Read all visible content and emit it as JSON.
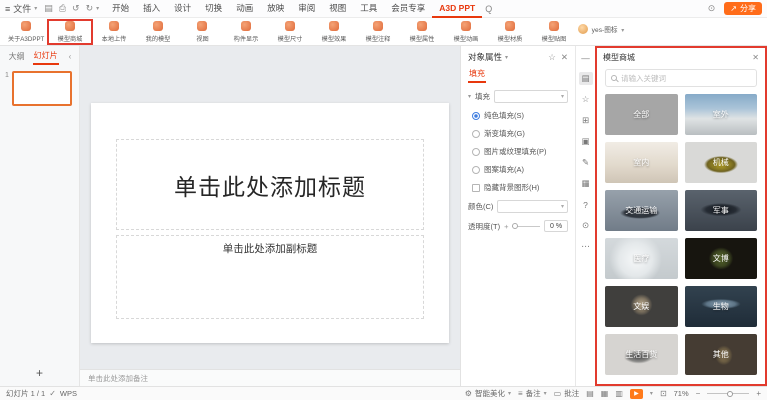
{
  "colors": {
    "accent": "#e8380d",
    "share_orange": "#ff6c1a",
    "annotation_red": "#e23b2e",
    "radio_selected_blue": "#3f7de0"
  },
  "topbar": {
    "file_menu": "文件",
    "menu_caret": "▾",
    "tabs": [
      "开始",
      "插入",
      "设计",
      "切换",
      "动画",
      "放映",
      "审阅",
      "视图",
      "工具",
      "会员专享",
      "A3D PPT"
    ],
    "search_glyph": "Q",
    "share_label": "分享",
    "share_icon": "↗",
    "history_icon": "⊙"
  },
  "ribbon": {
    "buttons": [
      "关于A3DPPT",
      "模型商城",
      "本地上传",
      "我的模型",
      "视图",
      "构件显示",
      "模型尺寸",
      "模型效果",
      "模型注释",
      "模型属性",
      "模型动画",
      "模型材质",
      "模型贴图"
    ],
    "user_label": "yes-图标",
    "user_caret": "▾"
  },
  "sidebar": {
    "outline_tab": "大纲",
    "slides_tab": "幻灯片",
    "collapse_glyph": "‹",
    "slide_number": "1",
    "add_slide": "+"
  },
  "canvas": {
    "title_placeholder": "单击此处添加标题",
    "subtitle_placeholder": "单击此处添加副标题",
    "notes_placeholder": "单击此处添加备注"
  },
  "props": {
    "title": "对象属性",
    "title_caret": "▾",
    "pin_icon": "☆",
    "close_icon": "✕",
    "fill_tab": "填充",
    "section_caret": "▾",
    "section_label": "填充",
    "select_caret": "▾",
    "options": [
      "纯色填充(S)",
      "渐变填充(G)",
      "图片或纹理填充(P)",
      "图案填充(A)"
    ],
    "checkbox_label": "隐藏背景图形(H)",
    "color_label": "颜色(C)",
    "opacity_label": "透明度(T)",
    "opacity_plus": "+",
    "opacity_value": "0",
    "percent": "%",
    "spin_caret": "▴▾"
  },
  "strip": {
    "icons": [
      {
        "name": "collapse-panel-icon",
        "glyph": "—"
      },
      {
        "name": "properties-panel-icon",
        "glyph": "▤"
      },
      {
        "name": "star-icon",
        "glyph": "☆"
      },
      {
        "name": "shapes-icon",
        "glyph": "⊞"
      },
      {
        "name": "picture-icon",
        "glyph": "▣"
      },
      {
        "name": "edit-icon",
        "glyph": "✎"
      },
      {
        "name": "layout-icon",
        "glyph": "▦"
      },
      {
        "name": "help-icon",
        "glyph": "?"
      },
      {
        "name": "schedule-icon",
        "glyph": "⊙"
      },
      {
        "name": "more-icon",
        "glyph": "⋯"
      }
    ]
  },
  "mall": {
    "title": "模型商城",
    "close_icon": "✕",
    "search_placeholder": "请输入关键词",
    "tiles": [
      {
        "label": "全部",
        "style": "background:#a6a6a6"
      },
      {
        "label": "室外",
        "style": "background:linear-gradient(180deg,#86aac8 0%,#aac4d8 35%,#dfe3e4 60%,#b9bec1 100%)"
      },
      {
        "label": "室内",
        "style": "background:linear-gradient(180deg,#f1ece5 0%,#e2dacd 55%,#cfc5b6 100%)"
      },
      {
        "label": "机械",
        "style": "background:radial-gradient(ellipse 38% 34% at 50% 55%,#c9b32e 0%,#6e6220 50%,rgba(217,217,215,0) 62%),#d9d9d7"
      },
      {
        "label": "交通运输",
        "style": "background:radial-gradient(ellipse 46% 24% at 48% 56%,#3f4750 0%,#2e343c 45%,rgba(126,137,148,0) 60%),linear-gradient(180deg,#97a1ab,#717c88)"
      },
      {
        "label": "军事",
        "style": "background:radial-gradient(ellipse 46% 26% at 50% 48%,#14181e 0%,#262c34 45%,rgba(90,99,109,0) 62%),linear-gradient(180deg,#5a636d,#3b424b)"
      },
      {
        "label": "医疗",
        "style": "background:radial-gradient(circle at 42% 52%,#f6f8f9 0%,#e4e8ea 35%,rgba(200,206,210,0) 55%),linear-gradient(180deg,#d4d9dc,#c4cacd)"
      },
      {
        "label": "文博",
        "style": "background:radial-gradient(ellipse 26% 42% at 50% 50%,#5f7030 0%,#3b4420 45%,rgba(23,21,15,0) 65%),#17150f"
      },
      {
        "label": "文娱",
        "style": "background:radial-gradient(ellipse 24% 42% at 50% 46%,#c2b194 0%,#7d7260 40%,rgba(64,63,61,0) 62%),#403f3d"
      },
      {
        "label": "生物",
        "style": "background:radial-gradient(ellipse 44% 20% at 50% 44%,#8ba2b4 0%,#5d7486 45%,rgba(38,52,66,0) 62%),linear-gradient(180deg,#32424f,#1f2c38)"
      },
      {
        "label": "生活百货",
        "style": "background:radial-gradient(ellipse 34% 28% at 46% 56%,#5a5a5a 0%,#8a8a88 40%,rgba(214,212,209,0) 58%),#d6d4d1"
      },
      {
        "label": "其他",
        "style": "background:radial-gradient(ellipse 20% 40% at 54% 52%,#97805c 0%,#6a5c42 40%,rgba(69,60,51,0) 60%),#453c33"
      }
    ]
  },
  "statusbar": {
    "slide_counter": "幻灯片 1 / 1",
    "check_icon": "✓",
    "wps_label": "WPS",
    "beautify_icon": "⚙",
    "beautify_label": "智能美化",
    "caret": "▾",
    "notes_icon": "≡",
    "notes_label": "备注",
    "comment_icon": "▭",
    "comment_label": "批注",
    "view_icons": [
      "▤",
      "▦",
      "▥"
    ],
    "play_icon": "▶",
    "fit_icon": "⊡",
    "zoom_value": "71%",
    "zoom_out": "−",
    "zoom_in": "+"
  }
}
